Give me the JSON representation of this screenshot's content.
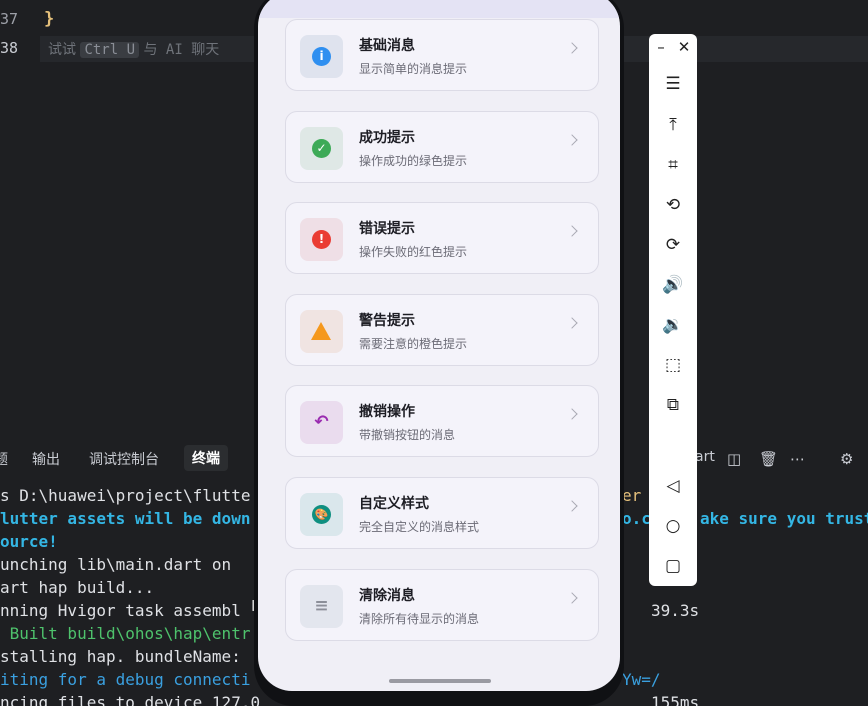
{
  "editor": {
    "line_37": "37",
    "line_38": "38",
    "code_brace": "}",
    "hint_prefix": "试试",
    "hint_kbd": "Ctrl U",
    "hint_suffix": "与 AI 聊天"
  },
  "terminal_panel": {
    "tabs": [
      {
        "label": "题"
      },
      {
        "label": "输出"
      },
      {
        "label": "调试控制台"
      },
      {
        "label": "终端"
      }
    ],
    "right_partial_label": "art",
    "lines": [
      "s D:\\huawei\\project\\flutte",
      "lutter assets will be down",
      "ource!",
      "unching lib\\main.dart on",
      "art hap build...",
      "nning Hvigor task assembl",
      " Built build\\ohos\\hap\\entr",
      "stalling hap. bundleName:",
      "iting for a debug connecti",
      "ncing files to device 127.0"
    ],
    "right_fragments": {
      "r1": "er",
      "r2": "o.c",
      "r2b": "ake sure you trust",
      "r6": "39.3s",
      "r9": "Yw=/",
      "r10": "155ms"
    }
  },
  "phone": {
    "cards": [
      {
        "title": "基础消息",
        "subtitle": "显示简单的消息提示",
        "icon": "info-icon",
        "color": "#2f8ff0",
        "bg": "#dfe3ee",
        "glyph": "i"
      },
      {
        "title": "成功提示",
        "subtitle": "操作成功的绿色提示",
        "icon": "check-circle-icon",
        "color": "#3daa57",
        "bg": "#dfe8e6",
        "glyph": "✓"
      },
      {
        "title": "错误提示",
        "subtitle": "操作失败的红色提示",
        "icon": "error-icon",
        "color": "#ea3c33",
        "bg": "#efdfe6",
        "glyph": "!"
      },
      {
        "title": "警告提示",
        "subtitle": "需要注意的橙色提示",
        "icon": "warning-icon",
        "color": "#f5981d",
        "bg": "#f0e4e2",
        "glyph": "!"
      },
      {
        "title": "撤销操作",
        "subtitle": "带撤销按钮的消息",
        "icon": "undo-icon",
        "color": "#9a2bb0",
        "bg": "#eadcee",
        "glyph": "↶"
      },
      {
        "title": "自定义样式",
        "subtitle": "完全自定义的消息样式",
        "icon": "palette-icon",
        "color": "#0f8f80",
        "bg": "#dae7ec",
        "glyph": "🎨"
      },
      {
        "title": "清除消息",
        "subtitle": "清除所有待显示的消息",
        "icon": "clear-all-icon",
        "color": "#8c8f99",
        "bg": "#e3e6ee",
        "glyph": "≡"
      }
    ]
  },
  "toolbar": {
    "items": [
      "minimize-icon",
      "close-icon",
      "menu-icon",
      "pin-top-icon",
      "crop-icon",
      "rotate-left-icon",
      "rotate-right-icon",
      "volume-up-icon",
      "volume-down-icon",
      "shake-icon",
      "multi-device-icon",
      "back-icon",
      "home-icon",
      "recents-icon"
    ]
  }
}
